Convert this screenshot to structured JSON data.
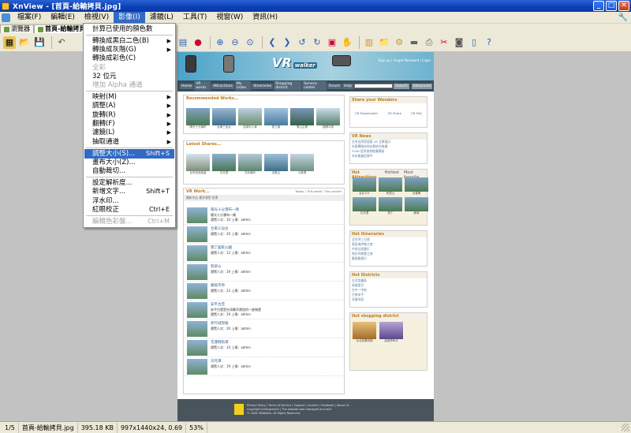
{
  "window": {
    "title": "XnView - [首頁-給輸拷貝.jpg]",
    "buttons": [
      "_",
      "□",
      "✕"
    ]
  },
  "menubar": [
    "檔案(F)",
    "編輯(E)",
    "檢視(V)",
    "影像(I)",
    "濾鏡(L)",
    "工具(T)",
    "視窗(W)",
    "資訊(H)"
  ],
  "tabs": [
    "瀏覽器",
    "首頁-給輸拷貝"
  ],
  "image_menu": {
    "items": [
      {
        "label": "計算已使用的顏色數",
        "shortcut": "",
        "submenu": false,
        "disabled": false
      },
      {
        "sep": true
      },
      {
        "label": "轉換成黑白二色(B)",
        "shortcut": "",
        "submenu": true,
        "disabled": false
      },
      {
        "label": "轉換成灰階(G)",
        "shortcut": "",
        "submenu": true,
        "disabled": false
      },
      {
        "label": "轉換成彩色(C)",
        "shortcut": "",
        "submenu": false,
        "disabled": false
      },
      {
        "label": "全彩",
        "shortcut": "",
        "submenu": false,
        "disabled": true
      },
      {
        "label": "32 位元",
        "shortcut": "",
        "submenu": false,
        "disabled": false
      },
      {
        "label": "增加 Alpha 通道",
        "shortcut": "",
        "submenu": false,
        "disabled": true
      },
      {
        "sep": true
      },
      {
        "label": "映射(M)",
        "shortcut": "",
        "submenu": true,
        "disabled": false
      },
      {
        "label": "調整(A)",
        "shortcut": "",
        "submenu": true,
        "disabled": false
      },
      {
        "label": "旋轉(R)",
        "shortcut": "",
        "submenu": true,
        "disabled": false
      },
      {
        "label": "翻轉(F)",
        "shortcut": "",
        "submenu": true,
        "disabled": false
      },
      {
        "label": "濾鏡(L)",
        "shortcut": "",
        "submenu": true,
        "disabled": false
      },
      {
        "label": "抽取通道",
        "shortcut": "",
        "submenu": true,
        "disabled": false
      },
      {
        "sep": true
      },
      {
        "label": "調整大小(S)...",
        "shortcut": "Shift+S",
        "submenu": false,
        "disabled": false,
        "highlight": true
      },
      {
        "label": "畫布大小(Z)...",
        "shortcut": "",
        "submenu": false,
        "disabled": false
      },
      {
        "label": "自動裁切...",
        "shortcut": "",
        "submenu": false,
        "disabled": false
      },
      {
        "sep": true
      },
      {
        "label": "設定解析度...",
        "shortcut": "",
        "submenu": false,
        "disabled": false
      },
      {
        "label": "新增文字...",
        "shortcut": "Shift+T",
        "submenu": false,
        "disabled": false
      },
      {
        "label": "浮水印...",
        "shortcut": "",
        "submenu": false,
        "disabled": false
      },
      {
        "label": "紅眼校正",
        "shortcut": "Ctrl+E",
        "submenu": false,
        "disabled": false
      },
      {
        "sep": true
      },
      {
        "label": "編輯色彩盤...",
        "shortcut": "Ctrl+M",
        "submenu": false,
        "disabled": true
      }
    ]
  },
  "webpage": {
    "logo": "VR",
    "logo_sub": "walker",
    "login": "Sign up | Forget Password | Login",
    "nav": [
      "Home",
      "VR works",
      "Attractions",
      "My index",
      "Itineraries",
      "Shopping district",
      "Service center",
      "Forum",
      "Help"
    ],
    "search_btn": "Search",
    "advsearch": "Advanced",
    "recommended_title": "Recommended Works...",
    "recommended": [
      "陽光十分瀑布",
      "台東三仙台",
      "澎湖天人菊",
      "夏之橋",
      "雪山主峰",
      "蘭陽平原"
    ],
    "latest_title": "Latest Shares...",
    "latest": [
      "台灣自然保留",
      "日月潭",
      "五彩瀑布",
      "合歡山",
      "七星潭"
    ],
    "vr_title": "VR Work...",
    "vr_filter": "Today / This week / This month",
    "vr_sub": "最新作品 最多瀏覽 投票",
    "vr_items": [
      {
        "name": "陽光十分瀑布一隅",
        "sub": "陽光十分瀑布一隅",
        "meta": "瀏覽人次：10 上傳：admin"
      },
      {
        "name": "台東三仙台",
        "sub": "",
        "meta": "瀏覽人次：20 上傳：admin"
      },
      {
        "name": "墾丁國家公園",
        "sub": "",
        "meta": "瀏覽人次：13 上傳：admin"
      },
      {
        "name": "翡翠山",
        "sub": "",
        "meta": "瀏覽人次：19 上傳：admin"
      },
      {
        "name": "蘭陽平原",
        "sub": "",
        "meta": "瀏覽人次：23 上傳：admin"
      },
      {
        "name": "安平古堡",
        "sub": "安平古堡是台灣最早建造的一座城堡",
        "meta": "瀏覽人次：19 上傳：admin"
      },
      {
        "name": "新竹城隍廟",
        "sub": "",
        "meta": "瀏覽人次：20 上傳：admin"
      },
      {
        "name": "花蓮鯉魚潭",
        "sub": "",
        "meta": "瀏覽人次：14 上傳：admin"
      },
      {
        "name": "日月潭",
        "sub": "",
        "meta": "瀏覽人次：19 上傳：admin"
      }
    ],
    "share_title": "Share your Wonders",
    "share_labels": [
      "VR Downloader",
      "VR Share",
      "VR FAQ"
    ],
    "news_title": "VR News",
    "news": [
      "台灣自然保留區 VR 全景展示",
      "台東縣政府與本網合作推廣",
      "2006 夏季旅遊推薦景點",
      "本站會員招募中"
    ],
    "attractions_title": "Hot Attractions",
    "attractions_tabs": [
      "Hottest",
      "Most favorite"
    ],
    "attractions": [
      "台北101",
      "阿里山",
      "太魯閣",
      "日月潭",
      "墾丁",
      "鹿港"
    ],
    "itin_title": "Hot Itineraries",
    "itin": [
      "北台灣三日遊",
      "東部海岸線之旅",
      "中部山區健行",
      "南台灣美食之旅",
      "離島跳島行"
    ],
    "district_title": "Hot Districts",
    "district": [
      "台北信義區",
      "高雄愛河",
      "台中一中街",
      "台南安平",
      "花蓮市區"
    ],
    "shop_title": "Hot shopping district",
    "shop": [
      "台北信義商圈",
      "高雄夢時代"
    ],
    "footer": [
      "Privacy Policy | Terms of Service | Support | Contact | Feedback | About Us",
      "Copyright Infringement | The website was managed and built",
      "© 2006 VRWalker. All Rights Reserved."
    ]
  },
  "statusbar": [
    "1/5",
    "首頁-給輸拷貝.jpg",
    "395.18 KB",
    "997x1440x24, 0.69",
    "53%"
  ]
}
